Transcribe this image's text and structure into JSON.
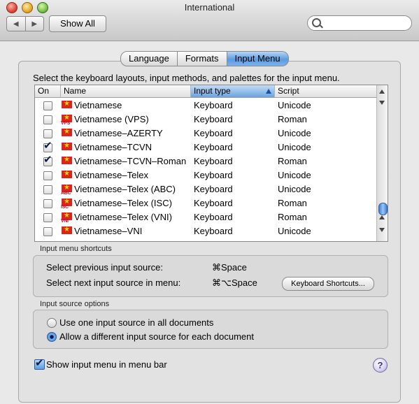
{
  "window": {
    "title": "International",
    "show_all_label": "Show All",
    "back_arrow": "◀",
    "forward_arrow": "▶",
    "search_placeholder": ""
  },
  "tabs": [
    {
      "label": "Language",
      "selected": false
    },
    {
      "label": "Formats",
      "selected": false
    },
    {
      "label": "Input Menu",
      "selected": true
    }
  ],
  "instructions": "Select the keyboard layouts, input methods, and palettes for the input menu.",
  "table": {
    "headers": {
      "on": "On",
      "name": "Name",
      "type": "Input type",
      "script": "Script"
    },
    "sorted_column": "Input type",
    "rows": [
      {
        "checked": false,
        "flag_label": "",
        "name": "Vietnamese",
        "type": "Keyboard",
        "script": "Unicode"
      },
      {
        "checked": false,
        "flag_label": "VPS",
        "name": "Vietnamese (VPS)",
        "type": "Keyboard",
        "script": "Roman"
      },
      {
        "checked": false,
        "flag_label": "",
        "name": "Vietnamese–AZERTY",
        "type": "Keyboard",
        "script": "Unicode"
      },
      {
        "checked": true,
        "flag_label": "",
        "name": "Vietnamese–TCVN",
        "type": "Keyboard",
        "script": "Unicode"
      },
      {
        "checked": true,
        "flag_label": "",
        "name": "Vietnamese–TCVN–Roman",
        "type": "Keyboard",
        "script": "Roman"
      },
      {
        "checked": false,
        "flag_label": "",
        "name": "Vietnamese–Telex",
        "type": "Keyboard",
        "script": "Unicode"
      },
      {
        "checked": false,
        "flag_label": "ABC",
        "name": "Vietnamese–Telex (ABC)",
        "type": "Keyboard",
        "script": "Unicode"
      },
      {
        "checked": false,
        "flag_label": "ISC",
        "name": "Vietnamese–Telex (ISC)",
        "type": "Keyboard",
        "script": "Roman"
      },
      {
        "checked": false,
        "flag_label": "VNI",
        "name": "Vietnamese–Telex (VNI)",
        "type": "Keyboard",
        "script": "Roman"
      },
      {
        "checked": false,
        "flag_label": "",
        "name": "Vietnamese–VNI",
        "type": "Keyboard",
        "script": "Unicode"
      }
    ]
  },
  "shortcuts": {
    "group_label": "Input menu shortcuts",
    "previous_label": "Select previous input source:",
    "previous_key": "⌘Space",
    "next_label": "Select next input source in menu:",
    "next_key": "⌘⌥Space",
    "keyboard_shortcuts_button": "Keyboard Shortcuts..."
  },
  "input_source": {
    "group_label": "Input source options",
    "option_one": "Use one input source in all documents",
    "option_two": "Allow a different input source for each document",
    "selected": "option_two"
  },
  "show_in_menu_bar": {
    "label": "Show input menu in menu bar",
    "checked": true
  },
  "help_label": "?"
}
